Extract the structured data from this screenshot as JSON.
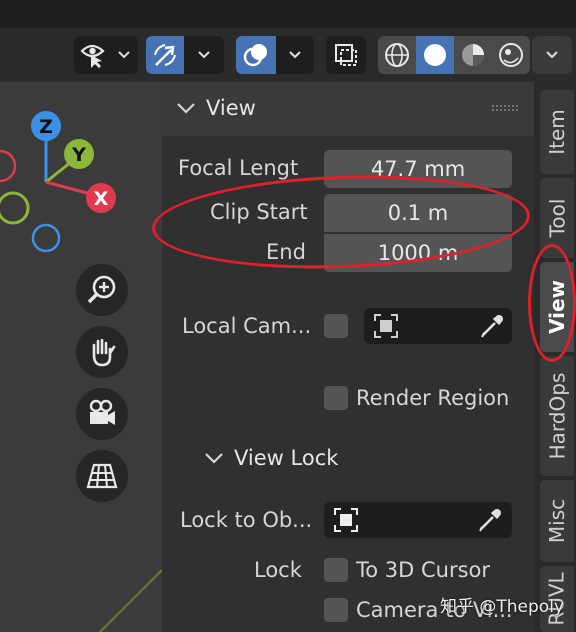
{
  "panel": {
    "title": "View",
    "focal_label": "Focal Lengt",
    "focal_value": "47.7 mm",
    "clip_start_label": "Clip Start",
    "clip_start_value": "0.1 m",
    "end_label": "End",
    "end_value": "1000 m",
    "local_camera_label": "Local Cam...",
    "render_region_label": "Render Region",
    "view_lock_title": "View Lock",
    "lock_to_object_label": "Lock to Ob...",
    "lock_label": "Lock",
    "to_3d_cursor_label": "To 3D Cursor",
    "camera_to_view_label": "Camera to Vi..."
  },
  "gizmo": {
    "z": "Z",
    "y": "Y",
    "x": "X"
  },
  "tabs": [
    {
      "label": "Item",
      "active": false
    },
    {
      "label": "Tool",
      "active": false
    },
    {
      "label": "View",
      "active": true
    },
    {
      "label": "HardOps",
      "active": false
    },
    {
      "label": "Misc",
      "active": false
    },
    {
      "label": "RUVL",
      "active": false
    }
  ],
  "watermark": "知乎 @Thepoly",
  "colors": {
    "accent": "#4772b3",
    "highlight_ring": "#e0202a",
    "axis_x": "#e23a4d",
    "axis_y": "#8bb83b",
    "axis_z": "#3e8fe6"
  }
}
